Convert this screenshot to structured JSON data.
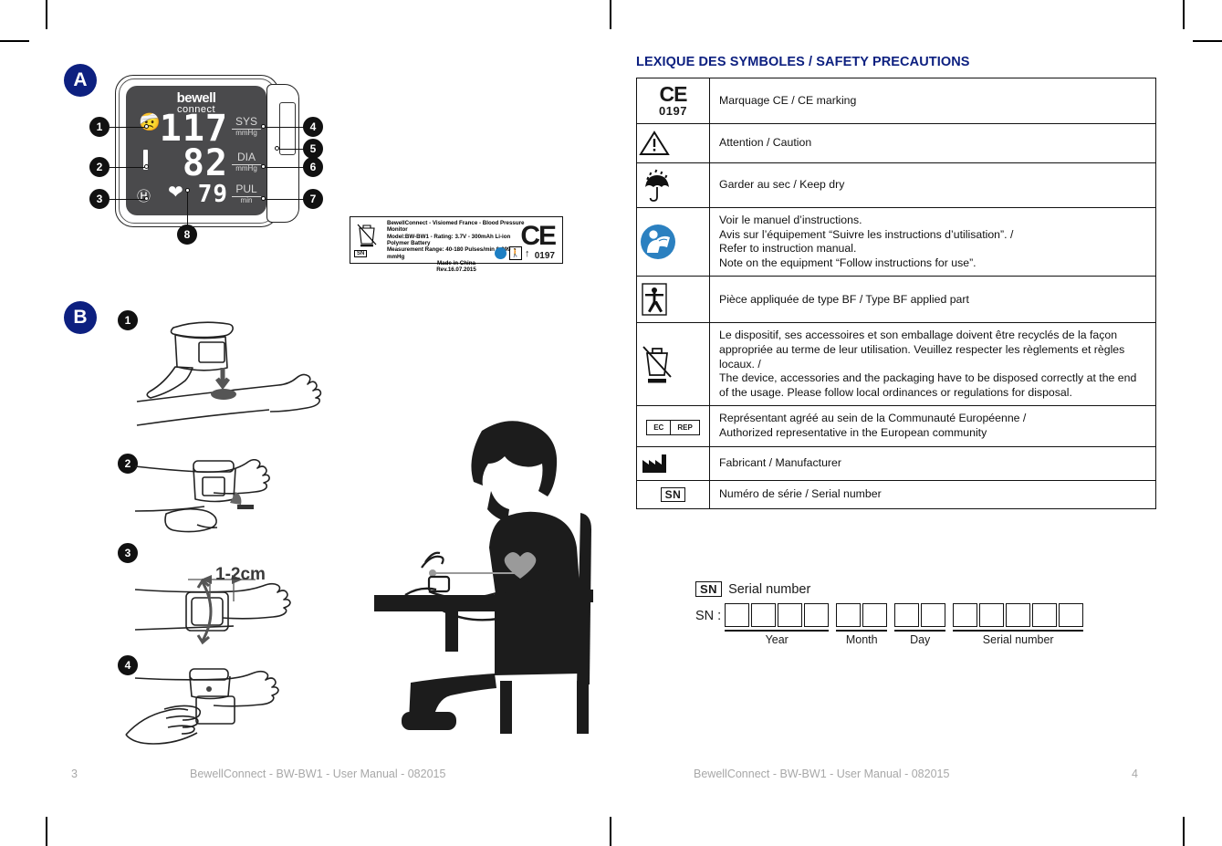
{
  "document": {
    "left_page": {
      "page_number": "3",
      "footer_text": "BewellConnect - BW-BW1 - User Manual - 082015"
    },
    "right_page": {
      "page_number": "4",
      "footer_text": "BewellConnect - BW-BW1 - User Manual - 082015"
    }
  },
  "section_a": {
    "badge": "A",
    "device": {
      "brand_line1": "bewell",
      "brand_line2": "connect",
      "sys_value": "117",
      "sys_label": "SYS",
      "sys_unit": "mmHg",
      "dia_value": "82",
      "dia_label": "DIA",
      "dia_unit": "mmHg",
      "pul_value": "79",
      "pul_label": "PUL",
      "pul_unit": "min"
    },
    "callouts": [
      "1",
      "2",
      "3",
      "4",
      "5",
      "6",
      "7",
      "8"
    ]
  },
  "product_label": {
    "line1": "BewellConnect - Visiomed France - Blood Pressure Monitor",
    "line2": "Model:BW-BW1 - Rating: 3.7V - 300mAh Li-ion Polymer Battery",
    "line3": "Measurement Range: 40-180 Pulses/min 0-299 mmHg",
    "line4": "Made in China",
    "line5": "Rev.16.07.2015",
    "sn_tag": "SN",
    "ce_mark": "CE",
    "notified_body": "0197"
  },
  "section_b": {
    "badge": "B",
    "steps": [
      "1",
      "2",
      "3",
      "4"
    ],
    "distance_label": "1-2cm"
  },
  "symbols_table": {
    "title": "LEXIQUE DES SYMBOLES / SAFETY PRECAUTIONS",
    "rows": [
      {
        "icon": "ce-marking-icon",
        "icon_text": "CE",
        "icon_sub": "0197",
        "text": "Marquage CE / CE marking"
      },
      {
        "icon": "warning-triangle-icon",
        "text": "Attention / Caution"
      },
      {
        "icon": "keep-dry-umbrella-icon",
        "text": "Garder au sec / Keep dry"
      },
      {
        "icon": "read-manual-icon",
        "text": "Voir le manuel d’instructions.\nAvis sur l’équipement “Suivre les instructions d’utilisation”. /\nRefer to instruction manual.\nNote on the equipment “Follow instructions for use”."
      },
      {
        "icon": "type-bf-applied-part-icon",
        "text": "Pièce appliquée de type BF / Type BF applied part"
      },
      {
        "icon": "weee-crossed-bin-icon",
        "text": "Le dispositif, ses accessoires et son emballage doivent être recyclés de la façon appropriée au terme de leur utilisation. Veuillez respecter les règlements et règles locaux. /\nThe device, accessories and the packaging have to be disposed correctly at the end of the usage. Please follow local ordinances or regulations for disposal."
      },
      {
        "icon": "ec-rep-icon",
        "icon_text": "EC",
        "icon_sub": "REP",
        "text": "Représentant agréé au sein de la Communauté Européenne /\nAuthorized representative in the European community"
      },
      {
        "icon": "manufacturer-factory-icon",
        "text": "Fabricant / Manufacturer"
      },
      {
        "icon": "serial-number-icon",
        "icon_text": "SN",
        "text": "Numéro de série / Serial number"
      }
    ]
  },
  "serial_number_block": {
    "tag": "SN",
    "heading": "Serial number",
    "prefix": "SN :",
    "groups": [
      {
        "label": "Year",
        "cells": 4
      },
      {
        "label": "Month",
        "cells": 2
      },
      {
        "label": "Day",
        "cells": 2
      },
      {
        "label": "Serial number",
        "cells": 5
      }
    ]
  },
  "colors": {
    "brand_blue": "#0d2080",
    "icon_blue": "#1d7fc3",
    "lcd_gray": "#4a4a4c",
    "footer_gray": "#a8a8a8"
  }
}
